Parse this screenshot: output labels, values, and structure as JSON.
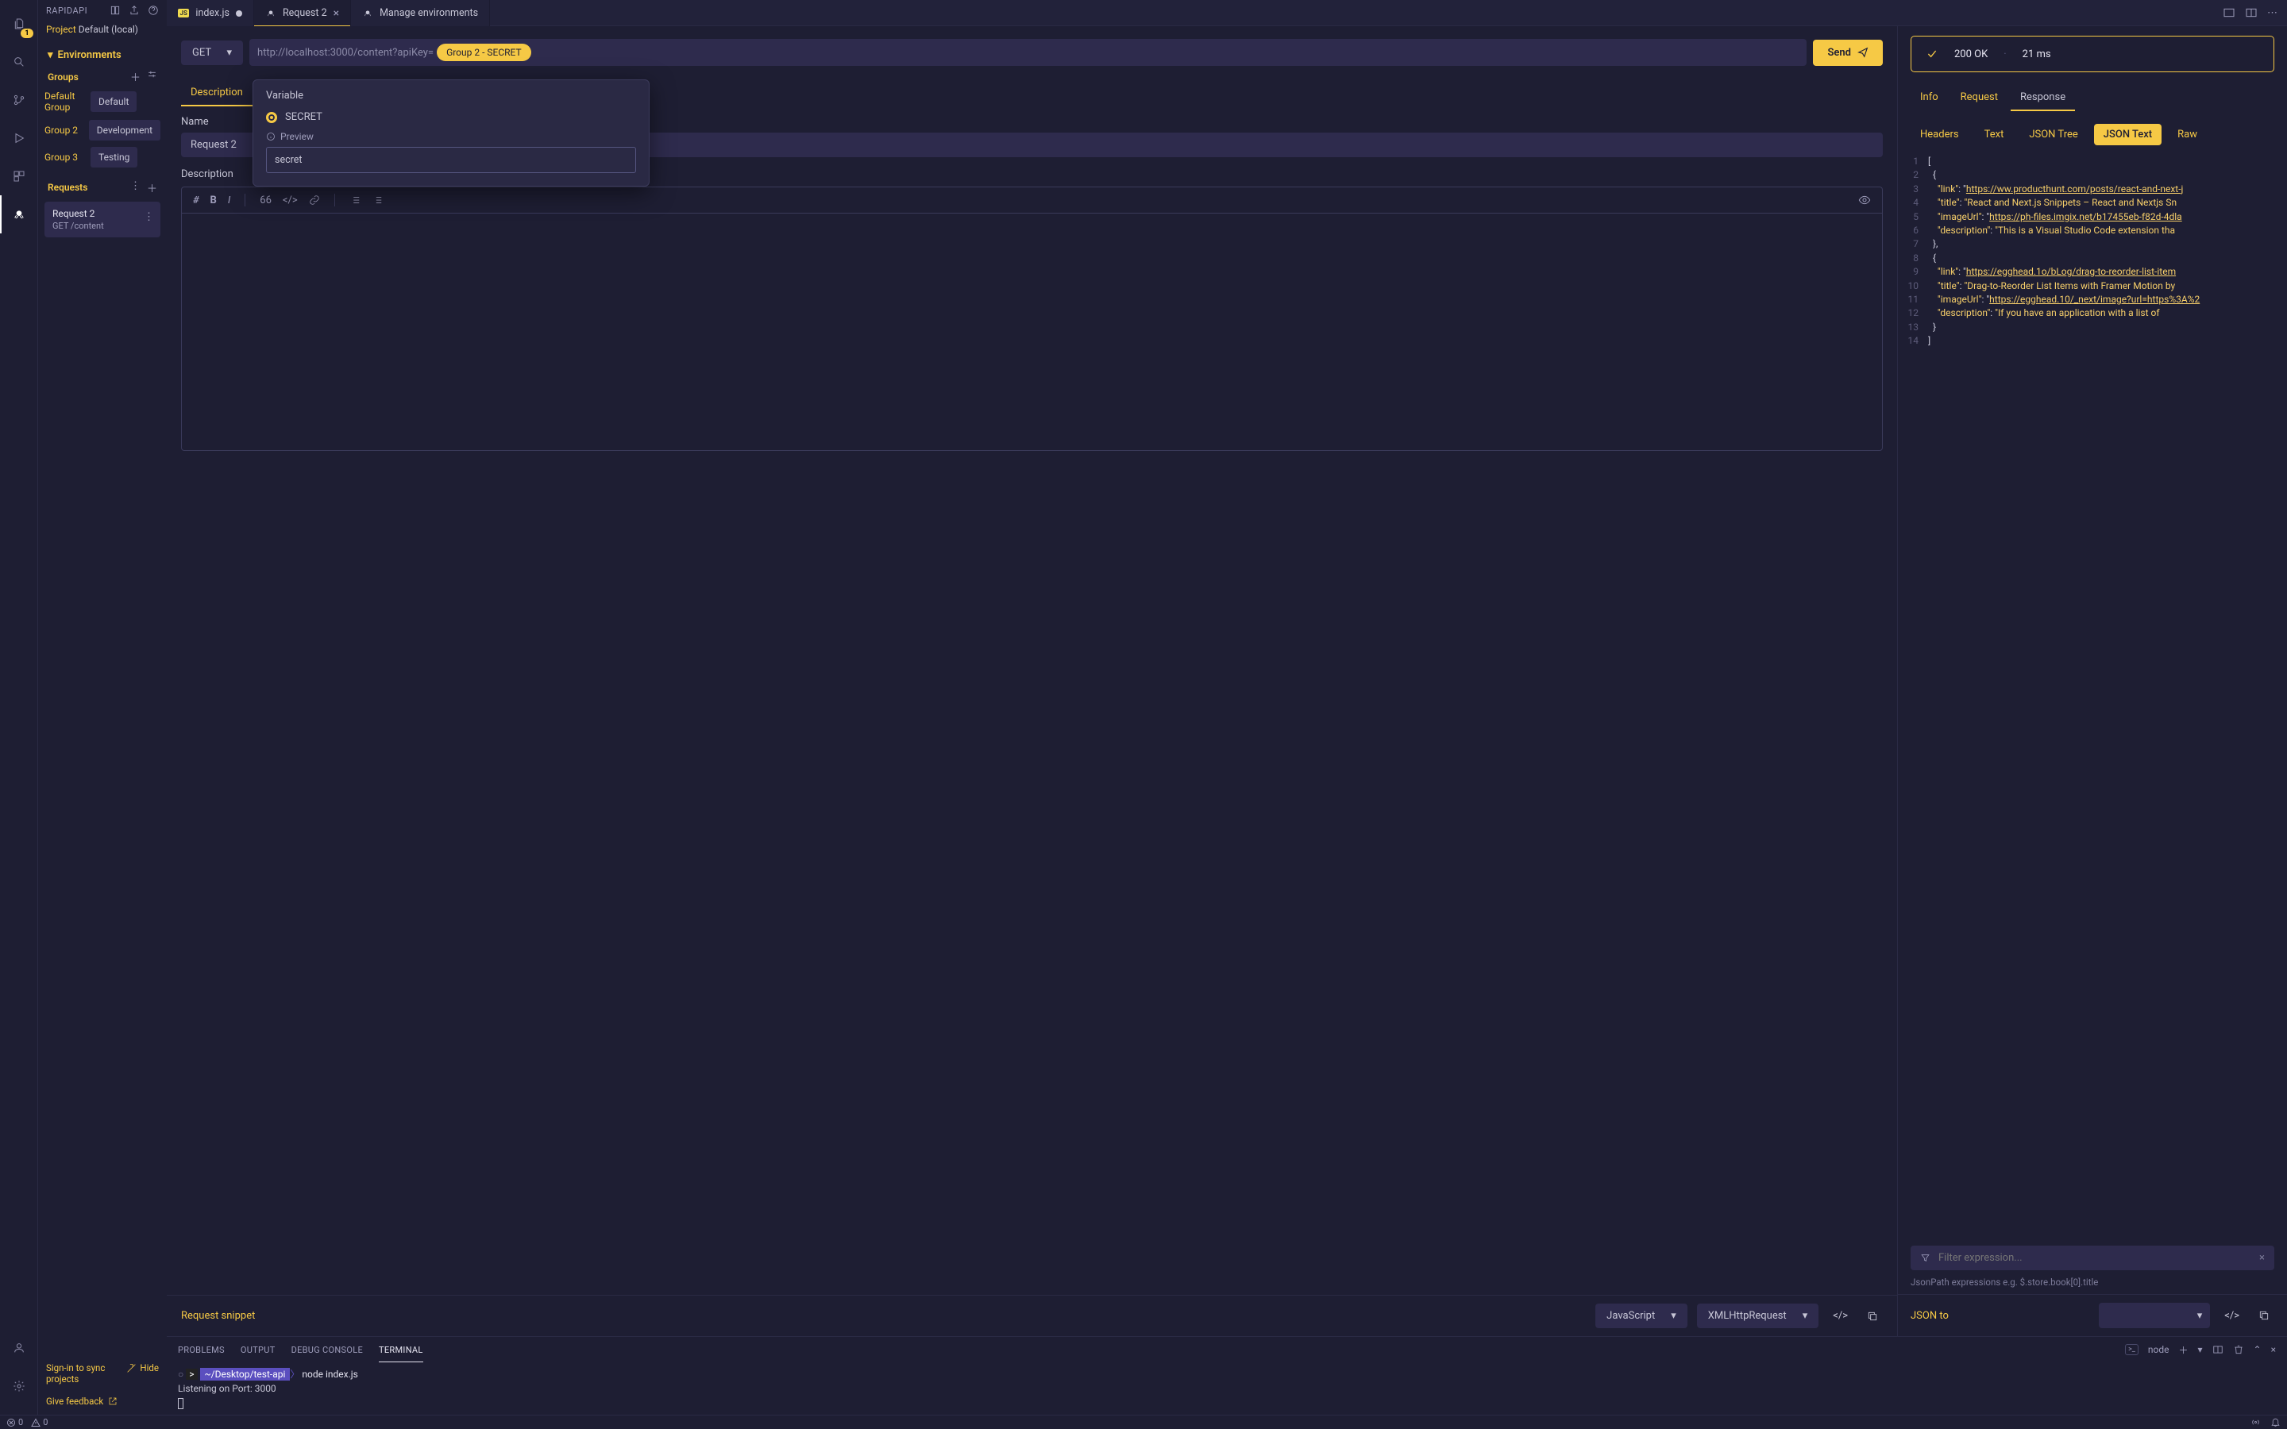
{
  "activityBadge": "1",
  "sidebar": {
    "title": "RAPIDAPI",
    "projectLabel": "Project",
    "projectValue": "Default (local)",
    "environmentsLabel": "Environments",
    "groupsLabel": "Groups",
    "groups": [
      {
        "name": "Default Group",
        "chip": "Default"
      },
      {
        "name": "Group 2",
        "chip": "Development"
      },
      {
        "name": "Group 3",
        "chip": "Testing"
      }
    ],
    "requestsLabel": "Requests",
    "requests": [
      {
        "name": "Request 2",
        "sub": "GET /content"
      }
    ],
    "syncText": "Sign-in to sync projects",
    "hideText": "Hide",
    "feedbackText": "Give feedback"
  },
  "tabs": {
    "index": "index.js",
    "request": "Request 2",
    "envs": "Manage environments"
  },
  "request": {
    "method": "GET",
    "url": "http://localhost:3000/content?apiKey=",
    "varChip": "Group 2 - SECRET",
    "sendLabel": "Send",
    "descTab": "Description",
    "nameLabel": "Name",
    "nameValue": "Request 2",
    "descLabel": "Description"
  },
  "popover": {
    "variableLabel": "Variable",
    "varOption": "SECRET",
    "previewLabel": "Preview",
    "previewValue": "secret"
  },
  "snippet": {
    "label": "Request snippet",
    "lang": "JavaScript",
    "lib": "XMLHttpRequest"
  },
  "response": {
    "status": "200 OK",
    "time": "21 ms",
    "tabs": {
      "info": "Info",
      "request": "Request",
      "response": "Response"
    },
    "viewTabs": {
      "headers": "Headers",
      "text": "Text",
      "jsonTree": "JSON Tree",
      "jsonText": "JSON Text",
      "raw": "Raw"
    },
    "filterPlaceholder": "Filter expression...",
    "filterHint": "JsonPath expressions e.g. $.store.book[0].title",
    "jsonToLabel": "JSON to",
    "code": [
      {
        "n": 1,
        "t": [
          {
            "c": "punc",
            "v": "["
          }
        ]
      },
      {
        "n": 2,
        "t": [
          {
            "c": "punc",
            "v": "  {"
          }
        ]
      },
      {
        "n": 3,
        "t": [
          {
            "c": "punc",
            "v": "    "
          },
          {
            "c": "key",
            "v": "\"link\""
          },
          {
            "c": "punc",
            "v": ": "
          },
          {
            "c": "punc",
            "v": "\""
          },
          {
            "c": "url",
            "v": "https://ww.producthunt.com/posts/react-and-next-j"
          }
        ]
      },
      {
        "n": 4,
        "t": [
          {
            "c": "punc",
            "v": "    "
          },
          {
            "c": "key",
            "v": "\"title\""
          },
          {
            "c": "punc",
            "v": ": "
          },
          {
            "c": "str",
            "v": "\"React and Next.js Snippets – React and Nextjs Sn"
          }
        ]
      },
      {
        "n": 5,
        "t": [
          {
            "c": "punc",
            "v": "    "
          },
          {
            "c": "key",
            "v": "\"imageUrl\""
          },
          {
            "c": "punc",
            "v": ": "
          },
          {
            "c": "punc",
            "v": "\""
          },
          {
            "c": "url",
            "v": "https://ph-files.imgix.net/b17455eb-f82d-4dla"
          }
        ]
      },
      {
        "n": 6,
        "t": [
          {
            "c": "punc",
            "v": "    "
          },
          {
            "c": "key",
            "v": "\"description\""
          },
          {
            "c": "punc",
            "v": ": "
          },
          {
            "c": "str",
            "v": "\"This is a Visual Studio Code extension tha"
          }
        ]
      },
      {
        "n": 7,
        "t": [
          {
            "c": "punc",
            "v": "  },"
          }
        ]
      },
      {
        "n": 8,
        "t": [
          {
            "c": "punc",
            "v": "  {"
          }
        ]
      },
      {
        "n": 9,
        "t": [
          {
            "c": "punc",
            "v": "    "
          },
          {
            "c": "key",
            "v": "\"link\""
          },
          {
            "c": "punc",
            "v": ": "
          },
          {
            "c": "punc",
            "v": "\""
          },
          {
            "c": "url",
            "v": "https://egghead.1o/bLog/drag-to-reorder-list-item"
          }
        ]
      },
      {
        "n": 10,
        "t": [
          {
            "c": "punc",
            "v": "    "
          },
          {
            "c": "key",
            "v": "\"title\""
          },
          {
            "c": "punc",
            "v": ": "
          },
          {
            "c": "str",
            "v": "\"Drag-to-Reorder List Items with Framer Motion by"
          }
        ]
      },
      {
        "n": 11,
        "t": [
          {
            "c": "punc",
            "v": "    "
          },
          {
            "c": "key",
            "v": "\"imageUrl\""
          },
          {
            "c": "punc",
            "v": ": "
          },
          {
            "c": "punc",
            "v": "\""
          },
          {
            "c": "url",
            "v": "https://egghead.10/_next/image?url=https%3A%2"
          }
        ]
      },
      {
        "n": 12,
        "t": [
          {
            "c": "punc",
            "v": "    "
          },
          {
            "c": "key",
            "v": "\"description\""
          },
          {
            "c": "punc",
            "v": ": "
          },
          {
            "c": "str",
            "v": "\"If you have an application with a list of "
          }
        ]
      },
      {
        "n": 13,
        "t": [
          {
            "c": "punc",
            "v": "  }"
          }
        ]
      },
      {
        "n": 14,
        "t": [
          {
            "c": "punc",
            "v": "]"
          }
        ]
      }
    ]
  },
  "bottomPanel": {
    "tabs": {
      "problems": "PROBLEMS",
      "output": "OUTPUT",
      "debug": "DEBUG CONSOLE",
      "terminal": "TERMINAL"
    },
    "shellType": "node",
    "promptPath": "~/Desktop/test-api",
    "command": "node index.js",
    "outputLine": "Listening on Port: 3000"
  },
  "statusBar": {
    "errors": "0",
    "warnings": "0"
  }
}
